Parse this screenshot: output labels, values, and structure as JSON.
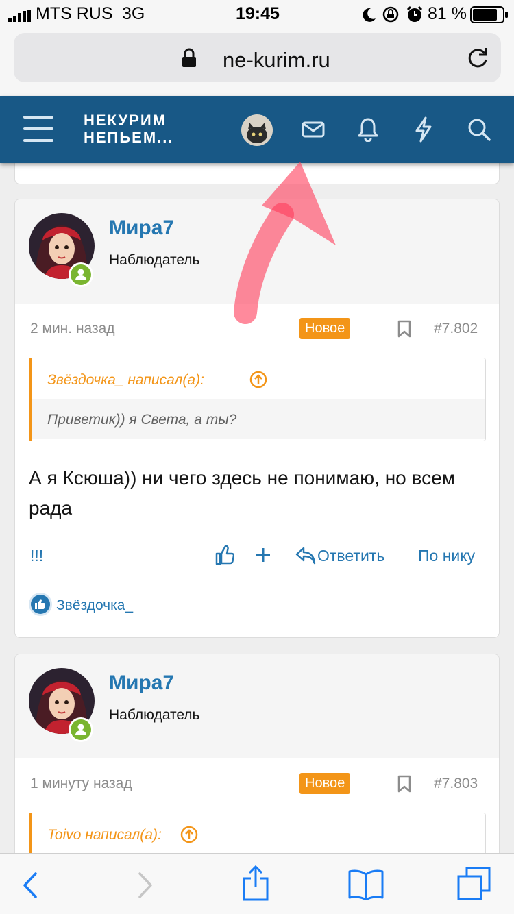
{
  "status_bar": {
    "carrier": "MTS RUS",
    "network": "3G",
    "time": "19:45",
    "battery": "81 %"
  },
  "browser": {
    "url": "ne-kurim.ru",
    "icons": [
      "lock-icon",
      "reload-icon",
      "back-icon",
      "forward-icon",
      "share-icon",
      "bookmarks-icon",
      "tabs-icon"
    ]
  },
  "header": {
    "logo_line1": "НЕКУРИМ",
    "logo_line2": "НЕПЬЕМ...",
    "icons": [
      "menu-icon",
      "avatar",
      "mail-icon",
      "bell-icon",
      "lightning-icon",
      "search-icon"
    ]
  },
  "posts": [
    {
      "username": "Мира7",
      "user_title": "Наблюдатель",
      "time": "2 мин. назад",
      "badge": "Новое",
      "number": "#7.802",
      "quote_author": "Звёздочка_ написал(а):",
      "quote_text": "Приветик)) я Света, а ты?",
      "message": "А я Ксюша)) ни чего здесь не понимаю, но всем рада",
      "actions": {
        "extra": "!!!",
        "reply": "Ответить",
        "by_nick": "По нику"
      },
      "likes": "Звёздочка_"
    },
    {
      "username": "Мира7",
      "user_title": "Наблюдатель",
      "time": "1 минуту назад",
      "badge": "Новое",
      "number": "#7.803",
      "quote_author": "Toivo написал(а):"
    }
  ],
  "colors": {
    "header_bg": "#185886",
    "link": "#2577b1",
    "accent_orange": "#f39518",
    "online_green": "#7ab530",
    "annotation_arrow": "#ff3c5a"
  }
}
